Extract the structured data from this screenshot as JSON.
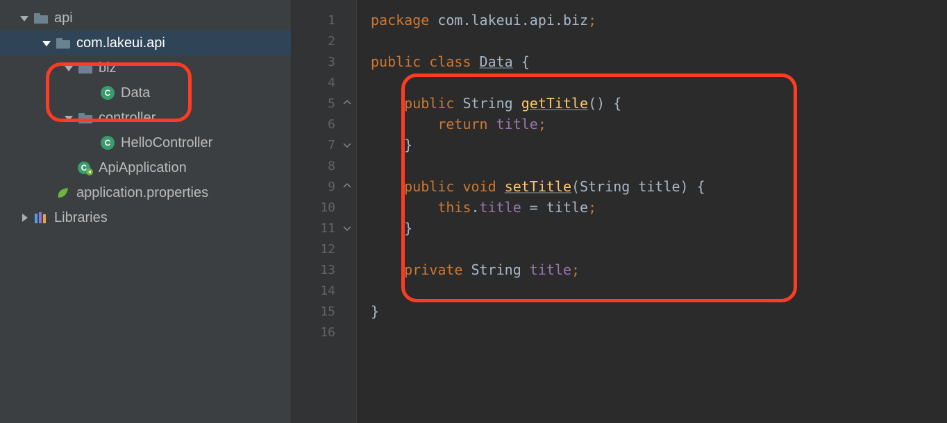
{
  "sidebar": {
    "items": [
      {
        "label": "api"
      },
      {
        "label": "com.lakeui.api"
      },
      {
        "label": "biz"
      },
      {
        "label": "Data"
      },
      {
        "label": "controller"
      },
      {
        "label": "HelloController"
      },
      {
        "label": "ApiApplication"
      },
      {
        "label": "application.properties"
      },
      {
        "label": "Libraries"
      }
    ]
  },
  "editor": {
    "lines": [
      "1",
      "2",
      "3",
      "4",
      "5",
      "6",
      "7",
      "8",
      "9",
      "10",
      "11",
      "12",
      "13",
      "14",
      "15",
      "16"
    ],
    "code": {
      "l1": {
        "kw1": "package ",
        "pkg": "com.lakeui.api.biz",
        "semi": ";"
      },
      "l3": {
        "kw1": "public ",
        "kw2": "class ",
        "cls": "Data",
        "open": " {"
      },
      "l5": {
        "kw1": "public ",
        "type": "String ",
        "mth": "getTitle",
        "paren": "() {"
      },
      "l6": {
        "kw1": "return ",
        "field": "title",
        "semi": ";"
      },
      "l7": {
        "close": "}"
      },
      "l9": {
        "kw1": "public ",
        "kw2": "void ",
        "mth": "setTitle",
        "paren1": "(String title) {"
      },
      "l10": {
        "kw1": "this",
        "dot": ".",
        "field": "title",
        "eq": " = title",
        "semi": ";"
      },
      "l11": {
        "close": "}"
      },
      "l13": {
        "kw1": "private ",
        "type": "String ",
        "field": "title",
        "semi": ";"
      },
      "l15": {
        "close": "}"
      }
    }
  }
}
